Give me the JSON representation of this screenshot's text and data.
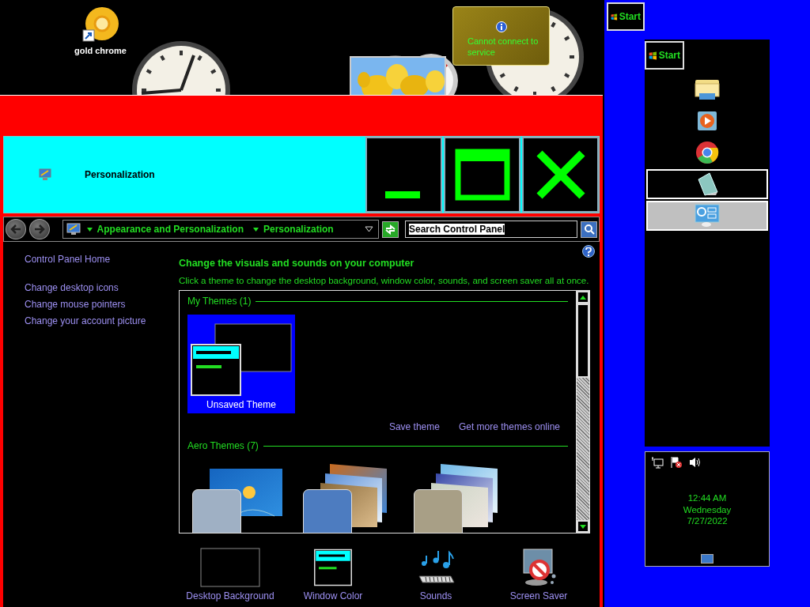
{
  "desktop": {
    "icons": [
      {
        "label": "gold chrome"
      }
    ],
    "feed_gadget": {
      "message": "Cannot connect to service"
    }
  },
  "window": {
    "title": "Personalization",
    "breadcrumb": [
      {
        "label": "Appearance and Personalization"
      },
      {
        "label": "Personalization"
      }
    ],
    "search": {
      "value": "Search Control Panel"
    }
  },
  "sidebar": {
    "items": [
      {
        "label": "Control Panel Home",
        "kind": "home"
      },
      {
        "label": "Change desktop icons",
        "kind": "task"
      },
      {
        "label": "Change mouse pointers",
        "kind": "task"
      },
      {
        "label": "Change your account picture",
        "kind": "task"
      }
    ]
  },
  "content": {
    "heading": "Change the visuals and sounds on your computer",
    "description": "Click a theme to change the desktop background, window color, sounds, and screen saver all at once.",
    "groups": [
      {
        "title": "My Themes (1)",
        "themes": [
          {
            "label": "Unsaved Theme",
            "kind": "custom",
            "selected": true
          }
        ],
        "links": [
          "Save theme",
          "Get more themes online"
        ]
      },
      {
        "title": "Aero Themes (7)",
        "themes": [
          {
            "kind": "aero",
            "selected": false,
            "color": "#9fb0c4"
          },
          {
            "kind": "aero",
            "selected": false,
            "color": "#4d7cc0"
          },
          {
            "kind": "aero",
            "selected": false,
            "color": "#a89f86"
          }
        ]
      }
    ],
    "settings": [
      {
        "label": "Desktop Background",
        "kind": "background"
      },
      {
        "label": "Window Color",
        "kind": "color"
      },
      {
        "label": "Sounds",
        "kind": "sounds"
      },
      {
        "label": "Screen Saver",
        "kind": "screensaver"
      }
    ]
  },
  "taskbar": {
    "start_buttons": [
      {
        "label": "Start"
      },
      {
        "label": "Start"
      }
    ],
    "apps": [
      {
        "kind": "folder",
        "running": false,
        "selected": false
      },
      {
        "kind": "media",
        "running": false,
        "selected": false
      },
      {
        "kind": "browser",
        "running": false,
        "selected": false
      },
      {
        "kind": "notepad",
        "running": true,
        "selected": false
      },
      {
        "kind": "control",
        "running": true,
        "selected": true
      }
    ],
    "clock": {
      "time": "12:44 AM",
      "day": "Wednesday",
      "date": "7/27/2022"
    }
  }
}
